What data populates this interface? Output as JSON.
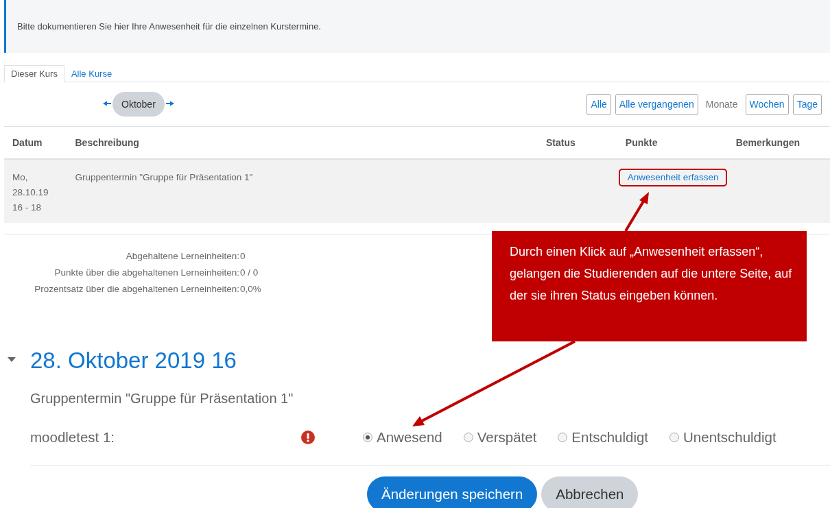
{
  "notice": "Bitte dokumentieren Sie hier Ihre Anwesenheit für die einzelnen Kurstermine.",
  "tabs": [
    {
      "label": "Dieser Kurs",
      "selected": true
    },
    {
      "label": "Alle Kurse",
      "selected": false
    }
  ],
  "month_nav": {
    "month": "Oktober"
  },
  "view_filters": [
    {
      "label": "Alle",
      "selected": false
    },
    {
      "label": "Alle vergangenen",
      "selected": false
    },
    {
      "label": "Monate",
      "selected": true
    },
    {
      "label": "Wochen",
      "selected": false
    },
    {
      "label": "Tage",
      "selected": false
    }
  ],
  "table": {
    "columns": [
      "Datum",
      "Beschreibung",
      "Status",
      "Punkte",
      "Bemerkungen"
    ],
    "rows": [
      {
        "date": "Mo, 28.10.19 16 - 18",
        "description": "Gruppentermin \"Gruppe für Präsentation 1\"",
        "action": "Anwesenheit erfassen",
        "highlighted": true
      }
    ]
  },
  "summary": [
    {
      "label": "Abgehaltene Lerneinheiten:",
      "value": "0"
    },
    {
      "label": "Punkte über die abgehaltenen Lerneinheiten:",
      "value": "0 / 0"
    },
    {
      "label": "Prozentsatz über die abgehaltenen Lerneinheiten:",
      "value": "0,0%"
    }
  ],
  "session": {
    "title": "28. Oktober 2019 16",
    "expanded": true,
    "description": "Gruppentermin \"Gruppe für Präsentation 1\"",
    "student": "moodletest 1:",
    "options": [
      {
        "label": "Anwesend",
        "selected": true
      },
      {
        "label": "Verspätet",
        "selected": false
      },
      {
        "label": "Entschuldigt",
        "selected": false
      },
      {
        "label": "Unentschuldigt",
        "selected": false
      }
    ]
  },
  "buttons": [
    {
      "label": "Änderungen speichern",
      "kind": "primary"
    },
    {
      "label": "Abbrechen",
      "kind": "secondary"
    }
  ],
  "callout": {
    "text": "Durch einen Klick auf „Anwesenheit erfassen“, gelangen die Studierenden auf die untere Seite, auf der sie ihren Status eingeben können."
  }
}
